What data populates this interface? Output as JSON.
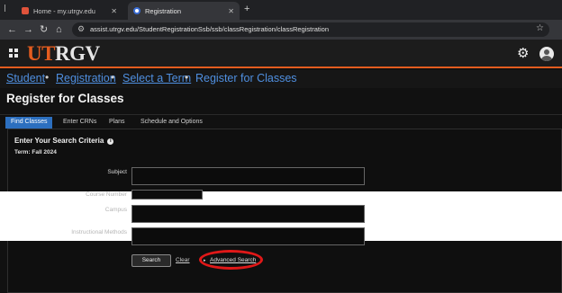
{
  "browser": {
    "tabs": [
      {
        "title": "Home - my.utrgv.edu"
      },
      {
        "title": "Registration"
      }
    ],
    "url": "assist.utrgv.edu/StudentRegistrationSsb/ssb/classRegistration/classRegistration"
  },
  "logo": {
    "ut": "UT",
    "rgv": "RGV"
  },
  "breadcrumb": {
    "student": "Student",
    "registration": "Registration",
    "select_term": "Select a Term",
    "current": "Register for Classes",
    "separator": "•"
  },
  "page_title": "Register for Classes",
  "tabs": [
    "Find Classes",
    "Enter CRNs",
    "Plans",
    "Schedule and Options"
  ],
  "search": {
    "title": "Enter Your Search Criteria",
    "term": "Term: Fall 2024",
    "labels": {
      "subject": "Subject",
      "course_number": "Course Number",
      "campus": "Campus",
      "instructional_methods": "Instructional Methods"
    },
    "search_button": "Search",
    "clear_link": "Clear",
    "advanced_link": "Advanced Search"
  },
  "colors": {
    "accent_orange": "#e35c1f",
    "link_blue": "#4f8fe0",
    "active_tab": "#2c6fbf",
    "highlight_circle": "#e01818"
  }
}
